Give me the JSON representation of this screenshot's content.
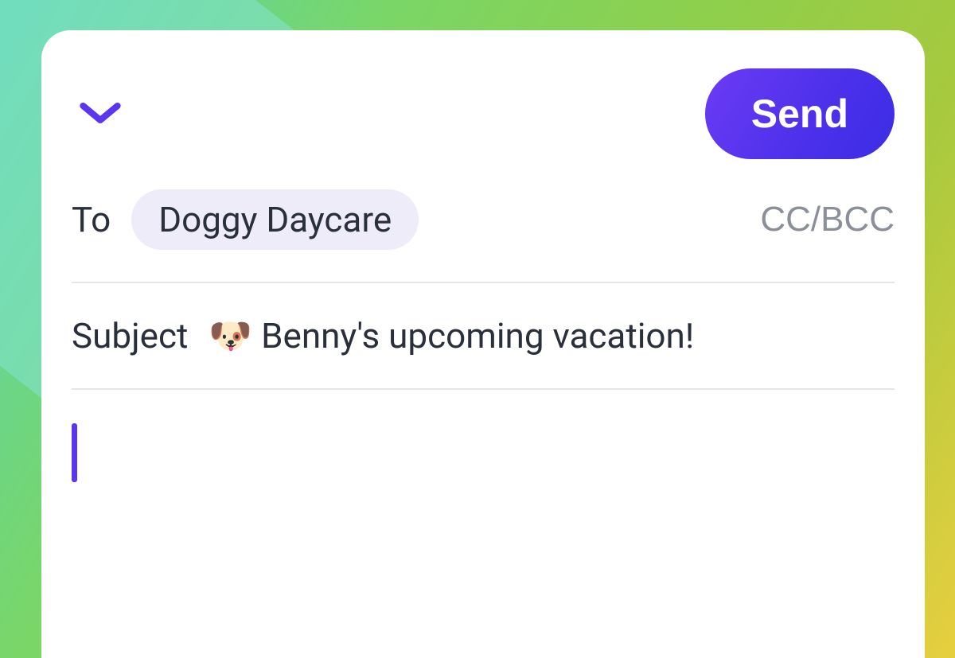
{
  "header": {
    "send_label": "Send"
  },
  "to": {
    "label": "To",
    "recipient_chip": "Doggy Daycare",
    "ccbcc_label": "CC/BCC"
  },
  "subject": {
    "label": "Subject",
    "value": "🐶 Benny's upcoming vacation!"
  },
  "body": {
    "content": ""
  },
  "icons": {
    "chevron": "chevron-down-icon"
  },
  "colors": {
    "accent": "#5b35ef",
    "send_gradient_start": "#6c3bf5",
    "send_gradient_end": "#3c2de6",
    "chip_bg": "#efecfa",
    "text": "#2a303b",
    "muted": "#8b8f99",
    "divider": "#e4e4e9"
  }
}
